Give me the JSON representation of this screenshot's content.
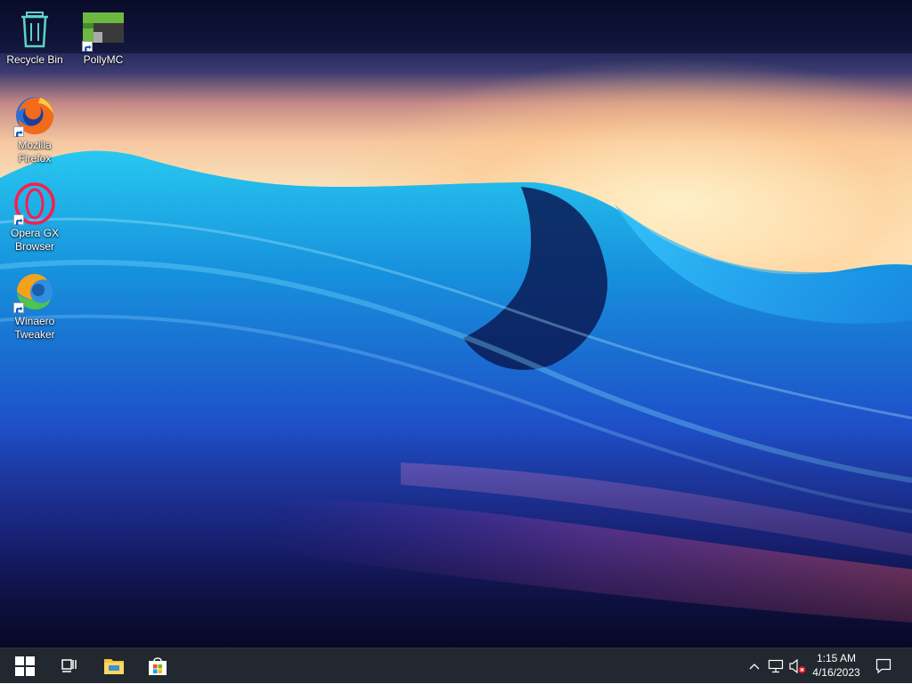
{
  "desktop": {
    "icons": [
      {
        "label": "Recycle Bin",
        "icon": "recycle-bin-icon"
      },
      {
        "label": "PollyMC",
        "icon": "pollymc-icon"
      },
      {
        "label": "Mozilla Firefox",
        "icon": "firefox-icon"
      },
      {
        "label": "Opera GX Browser",
        "icon": "opera-gx-icon"
      },
      {
        "label": "Winaero Tweaker",
        "icon": "winaero-tweaker-icon"
      }
    ]
  },
  "taskbar": {
    "start_icon": "windows-logo-icon",
    "task_view_icon": "task-view-icon",
    "file_explorer_icon": "folder-icon",
    "store_icon": "store-bag-icon",
    "tray": {
      "overflow_icon": "chevron-up-icon",
      "network_icon": "network-icon",
      "volume_icon": "volume-muted-icon",
      "notification_icon": "action-center-icon"
    },
    "clock": {
      "time": "1:15 AM",
      "date": "4/16/2023"
    }
  },
  "colors": {
    "taskbar_bg": "#22282f",
    "recycle_bin": "#5fd3c4",
    "pollymc_green": "#6db83f",
    "firefox_orange": "#f26a1b",
    "opera_gx_pink": "#fa1e4e",
    "mute_red": "#e81123"
  }
}
